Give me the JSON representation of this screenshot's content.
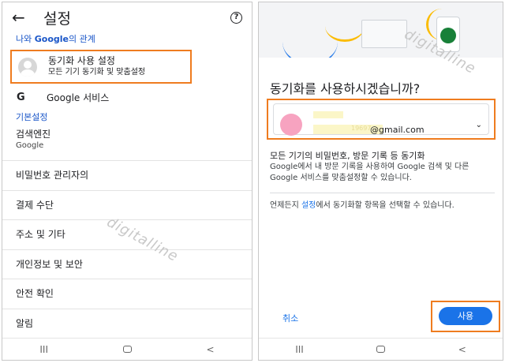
{
  "left": {
    "title": "설정",
    "section_prefix": "나와 ",
    "section_google": "Google",
    "section_suffix": "의 관계",
    "sync_title": "동기화 사용 설정",
    "sync_subtitle": "모든 기기 동기화 및 맞춤설정",
    "google_services_icon": "G",
    "google_services": "Google 서비스",
    "basic_settings": "기본설정",
    "search_engine_title": "검색엔진",
    "search_engine_value": "Google",
    "items": [
      "비밀번호 관리자의",
      "결제 수단",
      "주소 및 기타",
      "개인정보 및 보안",
      "안전 확인",
      "알림"
    ]
  },
  "right": {
    "title": "동기화를 사용하시겠습니까?",
    "email_suffix": "@gmail.com",
    "email_blur_fragment": "19697",
    "desc_head": "모든 기기의 비밀번호, 방문 기록 등 동기화",
    "desc_body": "Google에서 내 방문 기록을 사용하여 Google 검색 및 다른 Google 서비스를 맞춤설정할 수 있습니다.",
    "note_pre": "언제든지 ",
    "note_link": "설정",
    "note_post": "에서 동기화할 항목을 선택할 수 있습니다.",
    "cancel": "취소",
    "use": "사용"
  },
  "watermark": "digitalline",
  "nav": {
    "recents": "III",
    "back": "<"
  }
}
